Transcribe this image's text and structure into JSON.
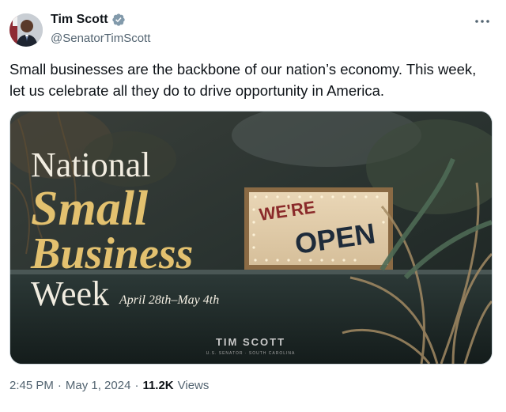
{
  "author": {
    "name": "Tim Scott",
    "handle": "@SenatorTimScott",
    "verified_icon": "verified-badge-icon"
  },
  "tweet": {
    "text": "Small businesses are the backbone of our nation’s economy. This week, let us celebrate all they do to drive opportunity in America."
  },
  "media": {
    "line1": "National",
    "line2": "Small",
    "line3": "Business",
    "line4": "Week",
    "dates": "April 28th–May 4th",
    "sign_top": "WE'RE",
    "sign_bottom": "OPEN",
    "brand": "TIM SCOTT",
    "brand_sub": "U.S. SENATOR · SOUTH CAROLINA"
  },
  "meta": {
    "time": "2:45 PM",
    "date": "May 1, 2024",
    "views_count": "11.2K",
    "views_label": "Views",
    "dot": "·"
  },
  "colors": {
    "gold": "#e3c16f",
    "text": "#0f1419",
    "muted": "#536471",
    "verified": "#829aab"
  }
}
